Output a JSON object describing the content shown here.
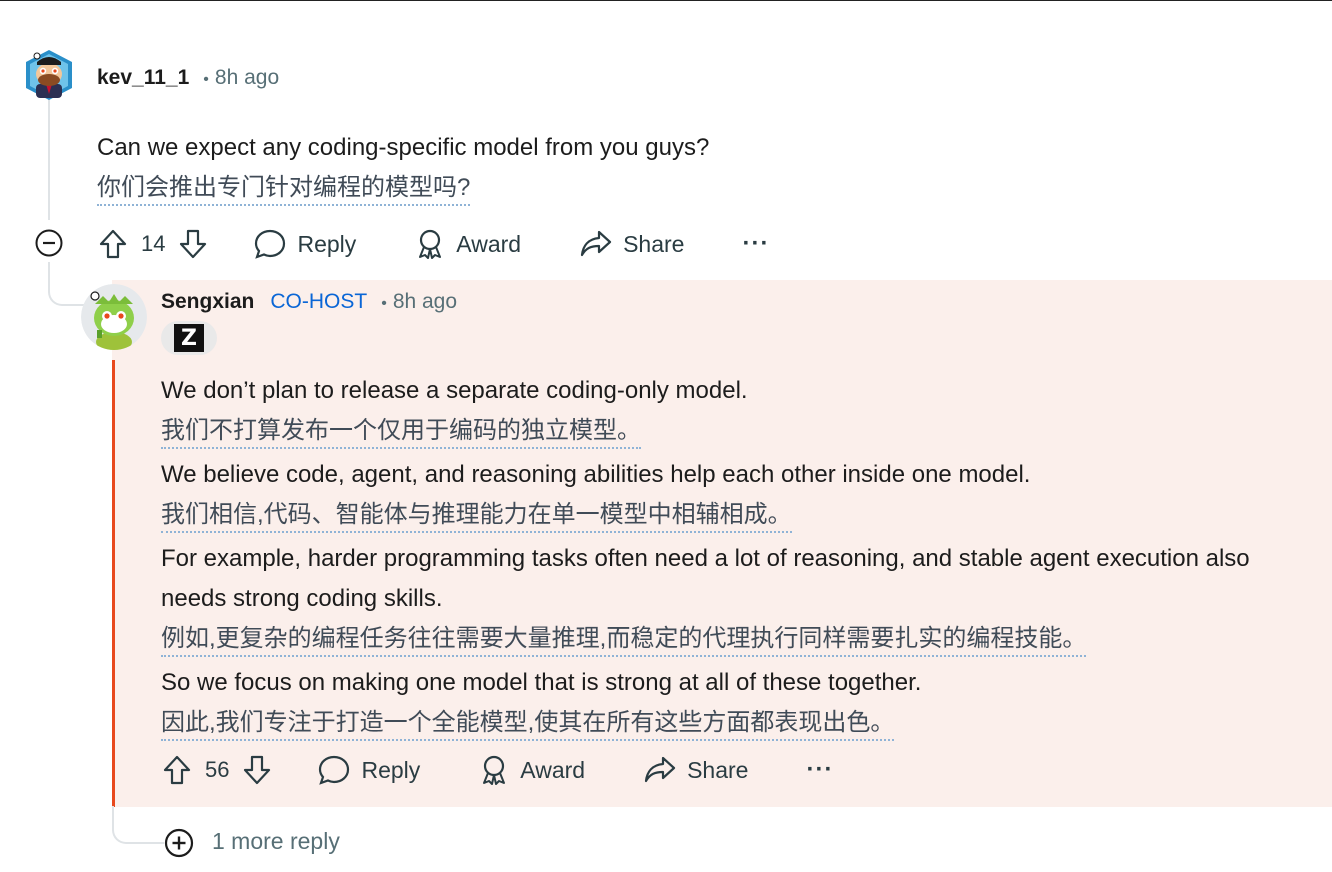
{
  "comment": {
    "username": "kev_11_1",
    "time": "8h ago",
    "text_en": "Can we expect any coding-specific model from you guys?",
    "text_zh": "你们会推出专门针对编程的模型吗?",
    "score": "14",
    "actions": {
      "reply": "Reply",
      "award": "Award",
      "share": "Share",
      "more": "···"
    }
  },
  "reply": {
    "username": "Sengxian",
    "role": "CO-HOST",
    "time": "8h ago",
    "flair": "Z",
    "lines": [
      "We don’t plan to release a separate coding-only model.",
      "我们不打算发布一个仅用于编码的独立模型。",
      "We believe code, agent, and reasoning abilities help each other inside one model.",
      "我们相信,代码、智能体与推理能力在单一模型中相辅相成。",
      "For example, harder programming tasks often need a lot of reasoning, and stable agent execution also needs strong coding skills.",
      "例如,更复杂的编程任务往往需要大量推理,而稳定的代理执行同样需要扎实的编程技能。",
      "So we focus on making one model that is strong at all of these together.",
      "因此,我们专注于打造一个全能模型,使其在所有这些方面都表现出色。"
    ],
    "score": "56",
    "actions": {
      "reply": "Reply",
      "award": "Award",
      "share": "Share",
      "more": "···"
    }
  },
  "more_replies": "1 more reply",
  "colors": {
    "highlight_bg": "#fbefeb",
    "accent_bar": "#e8491d",
    "cohost": "#0a66d6"
  }
}
